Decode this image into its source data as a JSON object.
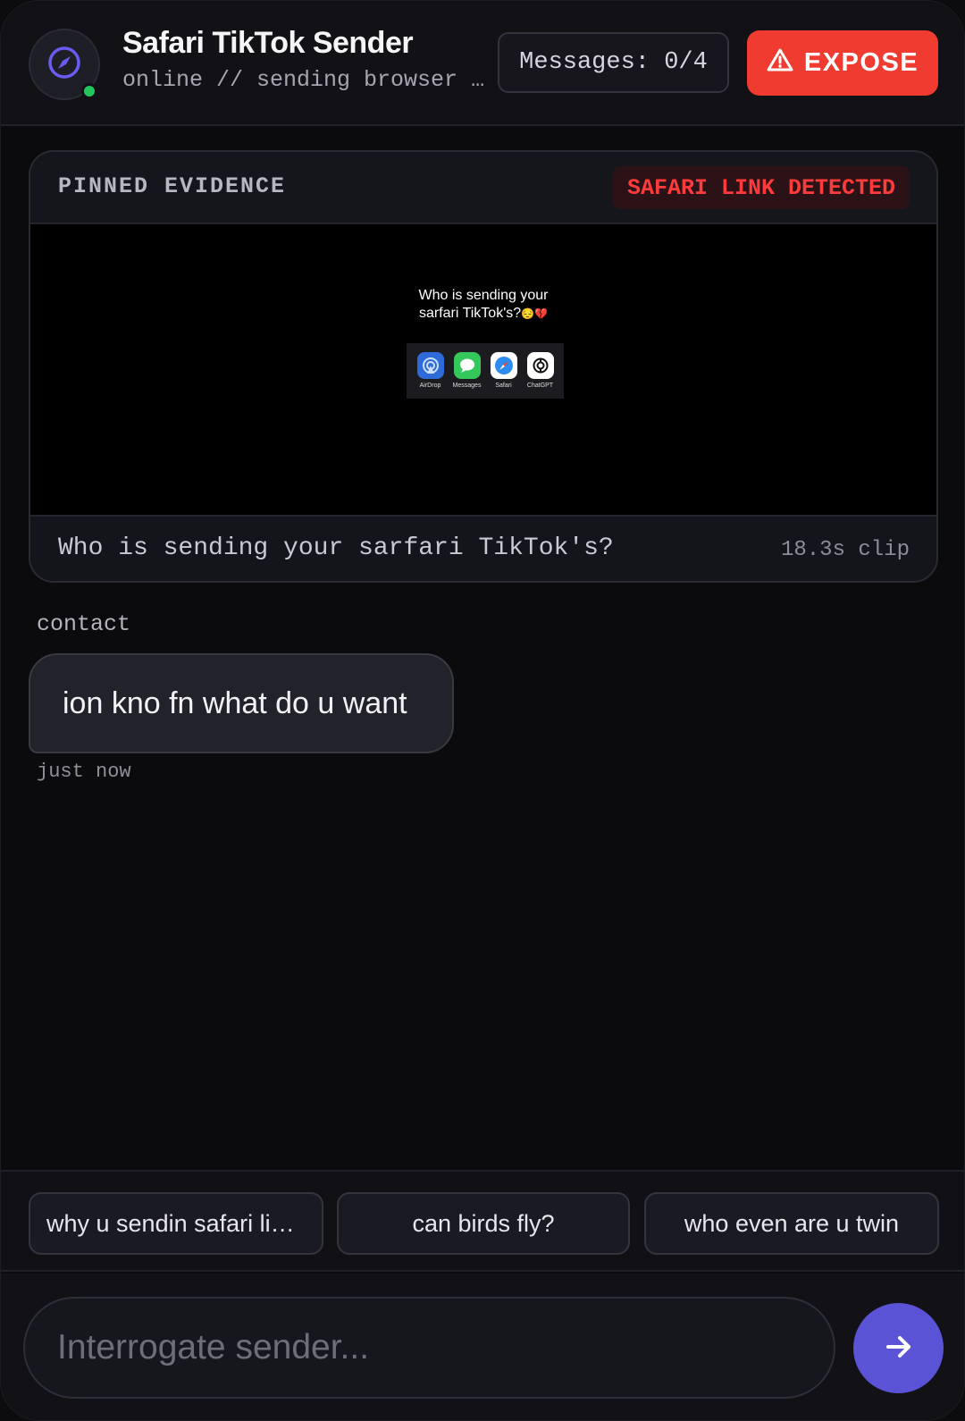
{
  "header": {
    "title": "Safari TikTok Sender",
    "status": "online // sending browser tiktoks",
    "counter": "Messages: 0/4",
    "expose_label": "EXPOSE",
    "avatar_icon": "compass-icon",
    "online_color": "#22c55e"
  },
  "pinned": {
    "label": "PINNED EVIDENCE",
    "badge": "SAFARI LINK DETECTED",
    "badge_color": "#ff3b3b",
    "video_caption_line1": "Who is sending your",
    "video_caption_line2": "sarfari TikTok's?",
    "video_caption_emoji": "😔💔",
    "share_apps": [
      {
        "label": "AirDrop",
        "icon": "airdrop-icon"
      },
      {
        "label": "Messages",
        "icon": "messages-icon"
      },
      {
        "label": "Safari",
        "icon": "safari-icon"
      },
      {
        "label": "ChatGPT",
        "icon": "chatgpt-icon"
      }
    ],
    "caption": "Who is sending your sarfari TikTok's?",
    "duration": "18.3s clip"
  },
  "messages": [
    {
      "sender": "contact",
      "text": "ion kno fn what do u want",
      "time": "just now"
    }
  ],
  "quick_replies": [
    "why u sendin safari links",
    "can birds fly?",
    "who even are u twin"
  ],
  "composer": {
    "placeholder": "Interrogate sender...",
    "send_icon": "arrow-right-icon",
    "accent": "#5b53d6"
  },
  "colors": {
    "expose": "#ef3b30",
    "background": "#0b0b0e"
  }
}
